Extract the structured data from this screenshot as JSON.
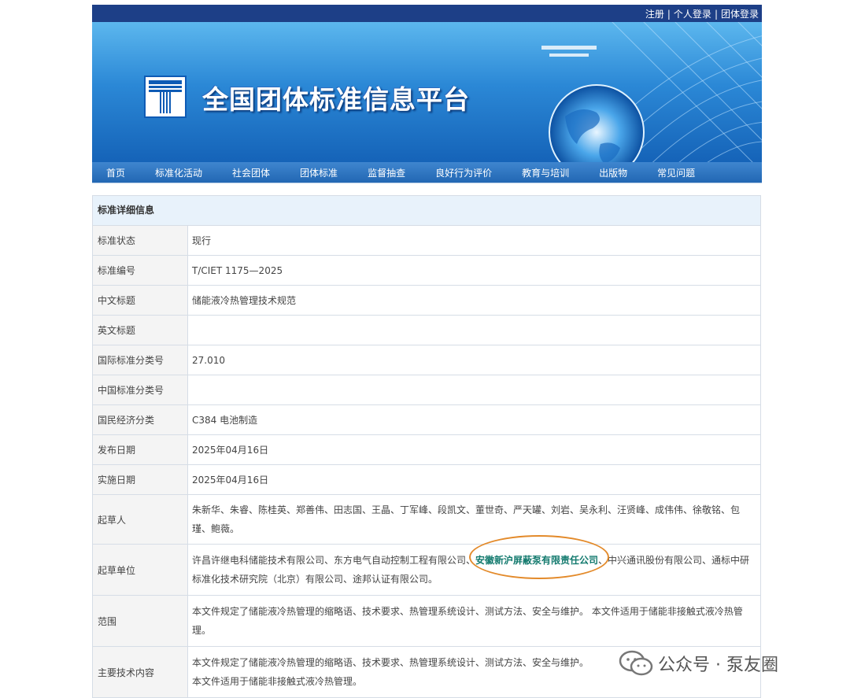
{
  "top_links": [
    "注册",
    "个人登录",
    "团体登录"
  ],
  "site": {
    "title": "全国团体标准信息平台"
  },
  "nav": [
    "首页",
    "标准化活动",
    "社会团体",
    "团体标准",
    "监督抽查",
    "良好行为评价",
    "教育与培训",
    "出版物",
    "常见问题"
  ],
  "detail": {
    "section_title": "标准详细信息",
    "rows": [
      {
        "label": "标准状态",
        "value": "现行"
      },
      {
        "label": "标准编号",
        "value": "T/CIET 1175—2025"
      },
      {
        "label": "中文标题",
        "value": "储能液冷热管理技术规范"
      },
      {
        "label": "英文标题",
        "value": ""
      },
      {
        "label": "国际标准分类号",
        "value": "27.010"
      },
      {
        "label": "中国标准分类号",
        "value": ""
      },
      {
        "label": "国民经济分类",
        "value": "C384 电池制造"
      },
      {
        "label": "发布日期",
        "value": "2025年04月16日"
      },
      {
        "label": "实施日期",
        "value": "2025年04月16日"
      }
    ],
    "drafters": {
      "label": "起草人",
      "line1": "朱新华、朱睿、陈桂英、郑善伟、田志国、王晶、丁军峰、段凯文、董世奇、严天罐、刘岩、吴永利、汪贤峰、成伟伟、徐敬铭、包",
      "line2": "瑾、鲍薇。"
    },
    "drafting_units": {
      "label": "起草单位",
      "line1_a": "许昌许继电科储能技术有限公司、东方电气自动控制工程有限公司、",
      "line1_highlight": "安徽新沪屏蔽泵有限责任公司",
      "line1_b": "、中兴通讯股份有限公司、通标中研",
      "line2": "标准化技术研究院（北京）有限公司、途邦认证有限公司。"
    },
    "scope": {
      "label": "范围",
      "line1": "本文件规定了储能液冷热管理的缩略语、技术要求、热管理系统设计、测试方法、安全与维护。 本文件适用于储能非接触式液冷热管",
      "line2": "理。"
    },
    "main_content": {
      "label": "主要技术内容",
      "line1": "本文件规定了储能液冷热管理的缩略语、技术要求、热管理系统设计、测试方法、安全与维护。",
      "line2": "本文件适用于储能非接触式液冷热管理。"
    }
  },
  "watermark": {
    "text": "公众号 · 泵友圈"
  },
  "colors": {
    "topbar": "#1d3f87",
    "nav": "#2267b3",
    "highlight": "#137a6e",
    "oval": "#e38a2a"
  }
}
